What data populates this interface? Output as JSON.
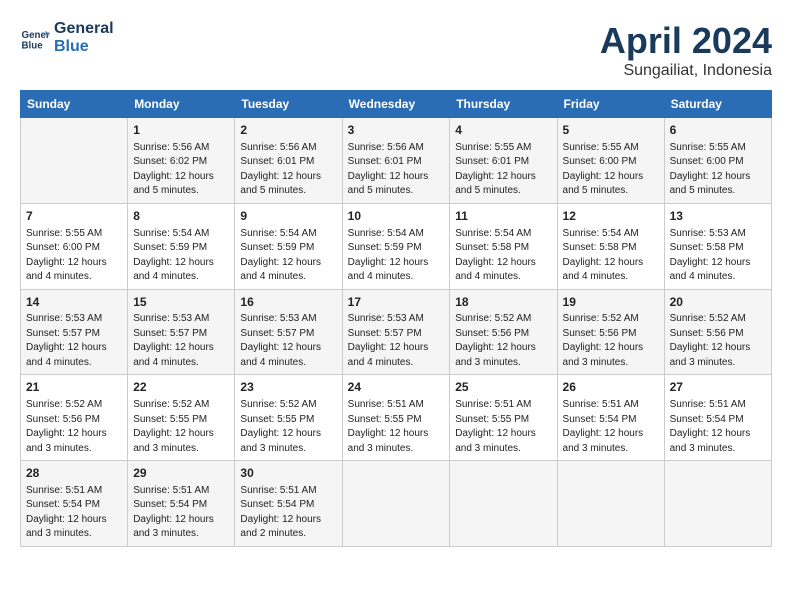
{
  "logo": {
    "line1": "General",
    "line2": "Blue"
  },
  "title": "April 2024",
  "subtitle": "Sungailiat, Indonesia",
  "header_days": [
    "Sunday",
    "Monday",
    "Tuesday",
    "Wednesday",
    "Thursday",
    "Friday",
    "Saturday"
  ],
  "weeks": [
    [
      {
        "num": "",
        "info": ""
      },
      {
        "num": "1",
        "info": "Sunrise: 5:56 AM\nSunset: 6:02 PM\nDaylight: 12 hours\nand 5 minutes."
      },
      {
        "num": "2",
        "info": "Sunrise: 5:56 AM\nSunset: 6:01 PM\nDaylight: 12 hours\nand 5 minutes."
      },
      {
        "num": "3",
        "info": "Sunrise: 5:56 AM\nSunset: 6:01 PM\nDaylight: 12 hours\nand 5 minutes."
      },
      {
        "num": "4",
        "info": "Sunrise: 5:55 AM\nSunset: 6:01 PM\nDaylight: 12 hours\nand 5 minutes."
      },
      {
        "num": "5",
        "info": "Sunrise: 5:55 AM\nSunset: 6:00 PM\nDaylight: 12 hours\nand 5 minutes."
      },
      {
        "num": "6",
        "info": "Sunrise: 5:55 AM\nSunset: 6:00 PM\nDaylight: 12 hours\nand 5 minutes."
      }
    ],
    [
      {
        "num": "7",
        "info": "Sunrise: 5:55 AM\nSunset: 6:00 PM\nDaylight: 12 hours\nand 4 minutes."
      },
      {
        "num": "8",
        "info": "Sunrise: 5:54 AM\nSunset: 5:59 PM\nDaylight: 12 hours\nand 4 minutes."
      },
      {
        "num": "9",
        "info": "Sunrise: 5:54 AM\nSunset: 5:59 PM\nDaylight: 12 hours\nand 4 minutes."
      },
      {
        "num": "10",
        "info": "Sunrise: 5:54 AM\nSunset: 5:59 PM\nDaylight: 12 hours\nand 4 minutes."
      },
      {
        "num": "11",
        "info": "Sunrise: 5:54 AM\nSunset: 5:58 PM\nDaylight: 12 hours\nand 4 minutes."
      },
      {
        "num": "12",
        "info": "Sunrise: 5:54 AM\nSunset: 5:58 PM\nDaylight: 12 hours\nand 4 minutes."
      },
      {
        "num": "13",
        "info": "Sunrise: 5:53 AM\nSunset: 5:58 PM\nDaylight: 12 hours\nand 4 minutes."
      }
    ],
    [
      {
        "num": "14",
        "info": "Sunrise: 5:53 AM\nSunset: 5:57 PM\nDaylight: 12 hours\nand 4 minutes."
      },
      {
        "num": "15",
        "info": "Sunrise: 5:53 AM\nSunset: 5:57 PM\nDaylight: 12 hours\nand 4 minutes."
      },
      {
        "num": "16",
        "info": "Sunrise: 5:53 AM\nSunset: 5:57 PM\nDaylight: 12 hours\nand 4 minutes."
      },
      {
        "num": "17",
        "info": "Sunrise: 5:53 AM\nSunset: 5:57 PM\nDaylight: 12 hours\nand 4 minutes."
      },
      {
        "num": "18",
        "info": "Sunrise: 5:52 AM\nSunset: 5:56 PM\nDaylight: 12 hours\nand 3 minutes."
      },
      {
        "num": "19",
        "info": "Sunrise: 5:52 AM\nSunset: 5:56 PM\nDaylight: 12 hours\nand 3 minutes."
      },
      {
        "num": "20",
        "info": "Sunrise: 5:52 AM\nSunset: 5:56 PM\nDaylight: 12 hours\nand 3 minutes."
      }
    ],
    [
      {
        "num": "21",
        "info": "Sunrise: 5:52 AM\nSunset: 5:56 PM\nDaylight: 12 hours\nand 3 minutes."
      },
      {
        "num": "22",
        "info": "Sunrise: 5:52 AM\nSunset: 5:55 PM\nDaylight: 12 hours\nand 3 minutes."
      },
      {
        "num": "23",
        "info": "Sunrise: 5:52 AM\nSunset: 5:55 PM\nDaylight: 12 hours\nand 3 minutes."
      },
      {
        "num": "24",
        "info": "Sunrise: 5:51 AM\nSunset: 5:55 PM\nDaylight: 12 hours\nand 3 minutes."
      },
      {
        "num": "25",
        "info": "Sunrise: 5:51 AM\nSunset: 5:55 PM\nDaylight: 12 hours\nand 3 minutes."
      },
      {
        "num": "26",
        "info": "Sunrise: 5:51 AM\nSunset: 5:54 PM\nDaylight: 12 hours\nand 3 minutes."
      },
      {
        "num": "27",
        "info": "Sunrise: 5:51 AM\nSunset: 5:54 PM\nDaylight: 12 hours\nand 3 minutes."
      }
    ],
    [
      {
        "num": "28",
        "info": "Sunrise: 5:51 AM\nSunset: 5:54 PM\nDaylight: 12 hours\nand 3 minutes."
      },
      {
        "num": "29",
        "info": "Sunrise: 5:51 AM\nSunset: 5:54 PM\nDaylight: 12 hours\nand 3 minutes."
      },
      {
        "num": "30",
        "info": "Sunrise: 5:51 AM\nSunset: 5:54 PM\nDaylight: 12 hours\nand 2 minutes."
      },
      {
        "num": "",
        "info": ""
      },
      {
        "num": "",
        "info": ""
      },
      {
        "num": "",
        "info": ""
      },
      {
        "num": "",
        "info": ""
      }
    ]
  ]
}
